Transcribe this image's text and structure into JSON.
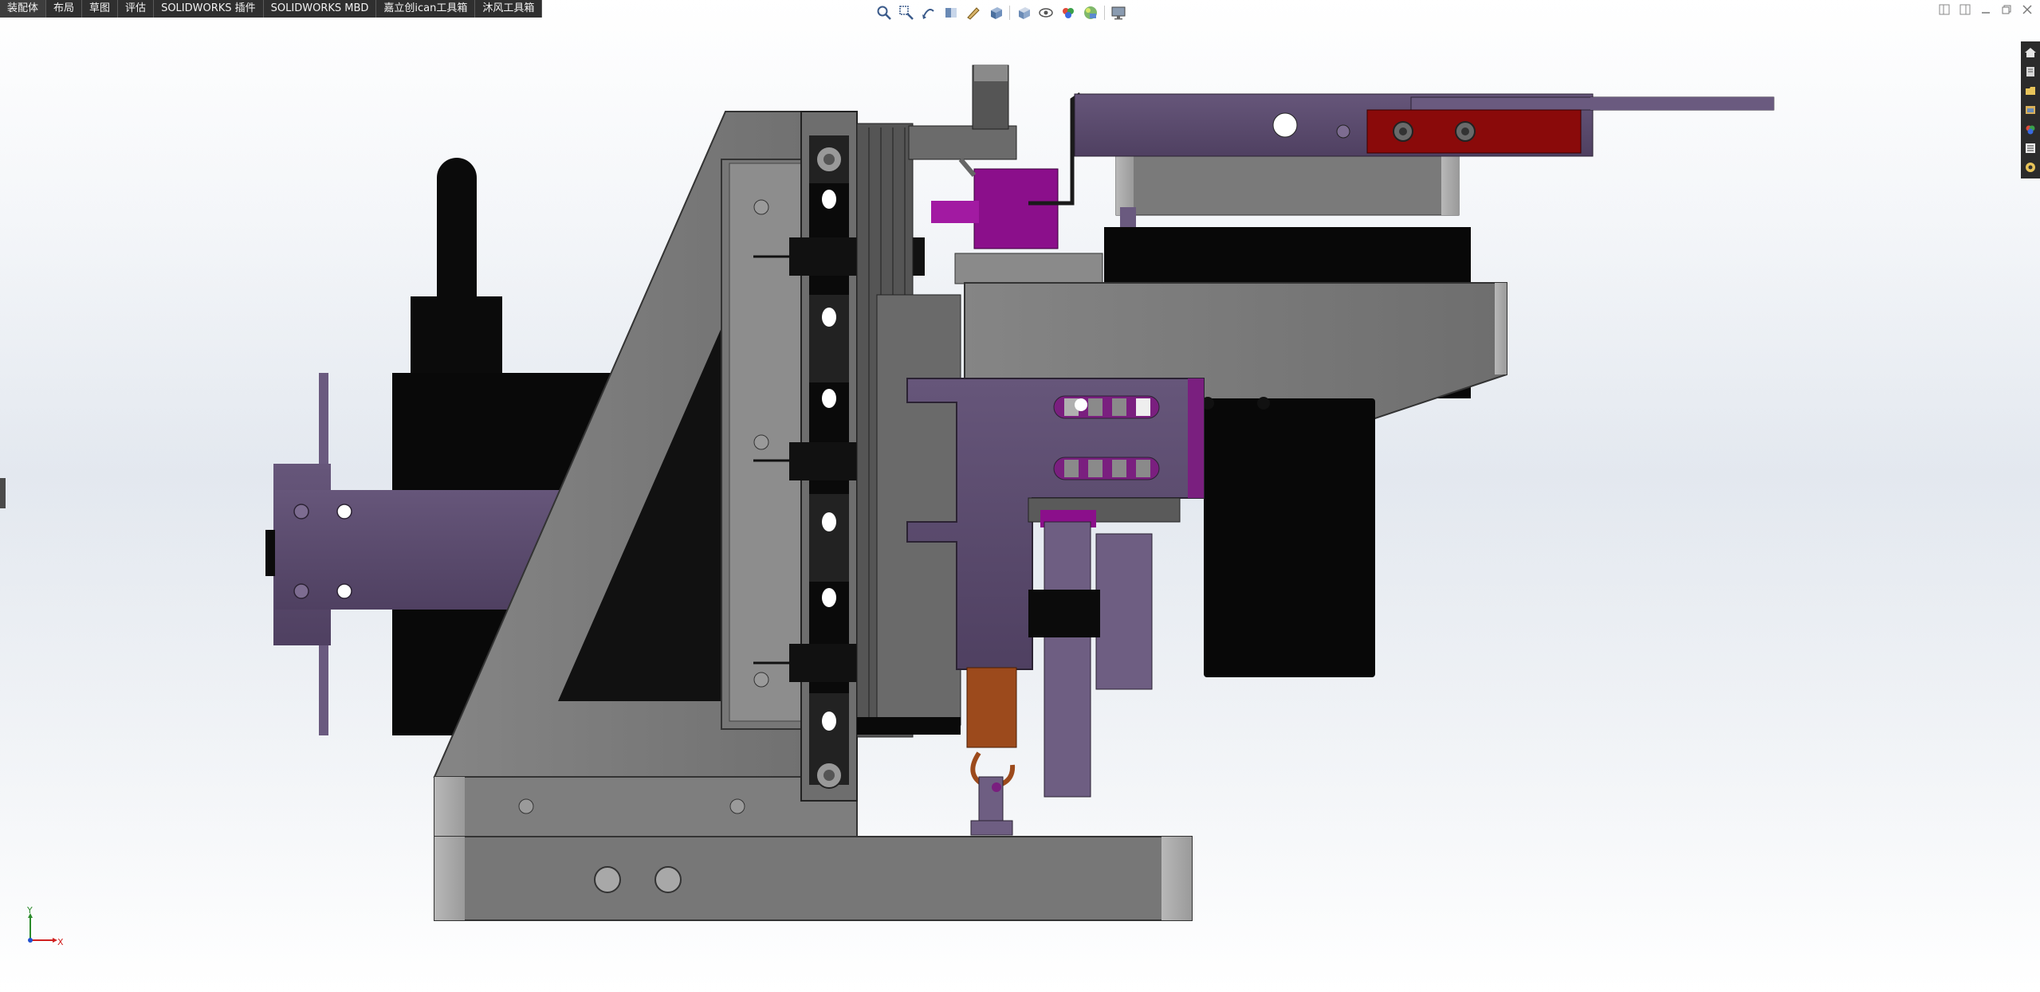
{
  "commandmanager": {
    "tabs": [
      {
        "label": "装配体"
      },
      {
        "label": "布局"
      },
      {
        "label": "草图"
      },
      {
        "label": "评估"
      },
      {
        "label": "SOLIDWORKS 插件"
      },
      {
        "label": "SOLIDWORKS MBD"
      },
      {
        "label": "嘉立创ican工具箱"
      },
      {
        "label": "沐风工具箱"
      }
    ]
  },
  "heads_up_toolbar": {
    "icons": [
      "zoom-to-fit-icon",
      "zoom-to-area-icon",
      "previous-view-icon",
      "section-view-icon",
      "dynamic-annotation-icon",
      "view-orientation-icon",
      "display-style-icon",
      "hide-show-items-icon",
      "edit-appearance-icon",
      "apply-scene-icon",
      "view-settings-icon"
    ]
  },
  "window_controls": {
    "icons": [
      "tile-left-icon",
      "tile-right-icon",
      "minimize-icon",
      "restore-icon",
      "close-icon"
    ]
  },
  "task_pane": {
    "icons": [
      "home-icon",
      "resources-icon",
      "design-library-icon",
      "file-explorer-icon",
      "view-palette-icon",
      "appearances-icon",
      "custom-properties-icon"
    ]
  },
  "triad": {
    "y_label": "Y",
    "x_label": "X"
  },
  "colors": {
    "tabbar_bg": "#2f2f2f",
    "part_gray": "#7a7a7a",
    "part_purple": "#5b4a6e",
    "part_magenta": "#8b0f8b",
    "part_red": "#8a0a0a",
    "part_black": "#0a0a0a",
    "part_copper": "#9c4a1c"
  }
}
